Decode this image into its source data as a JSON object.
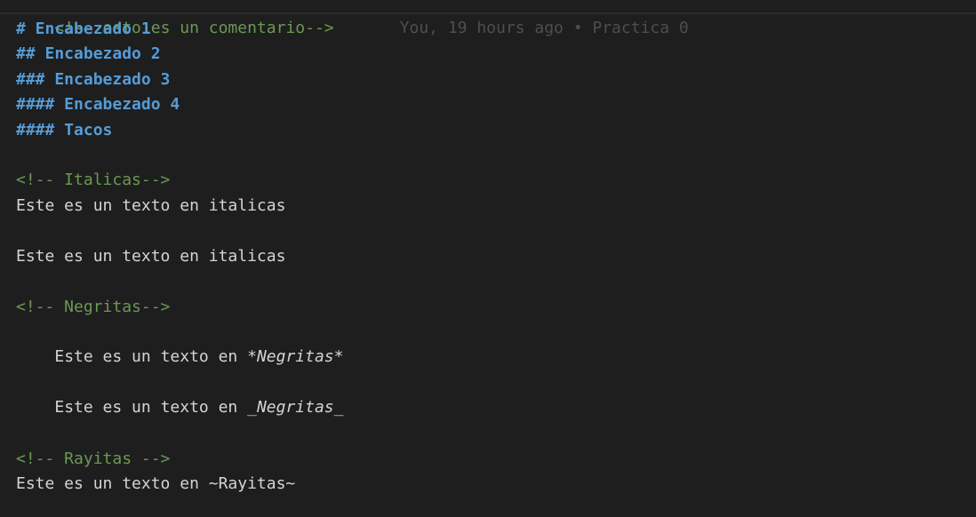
{
  "editor": {
    "current_line": {
      "text": "<!-- esto es un comentario-->",
      "blame": "You, 19 hours ago • Practica 0"
    },
    "headings": [
      "# Encabezado 1",
      "## Encabezado 2",
      "### Encabezado 3",
      "#### Encabezado 4",
      "#### Tacos"
    ],
    "italics_comment": "<!-- Italicas-->",
    "italics_lines": [
      "Este es un texto en italicas",
      "Este es un texto en italicas"
    ],
    "bold_comment": "<!-- Negritas-->",
    "bold_lines": [
      {
        "prefix": "Este es un texto en ",
        "emphasis": "*Negritas*"
      },
      {
        "prefix": "Este es un texto en ",
        "emphasis": "_Negritas_"
      }
    ],
    "strike_comment": "<!-- Rayitas -->",
    "strike_line": "Este es un texto en ~Rayitas~"
  },
  "colors": {
    "background": "#1e1e1e",
    "comment": "#6a9955",
    "heading": "#569cd6",
    "text": "#d4d4d4",
    "blame": "#4e4e4e"
  }
}
